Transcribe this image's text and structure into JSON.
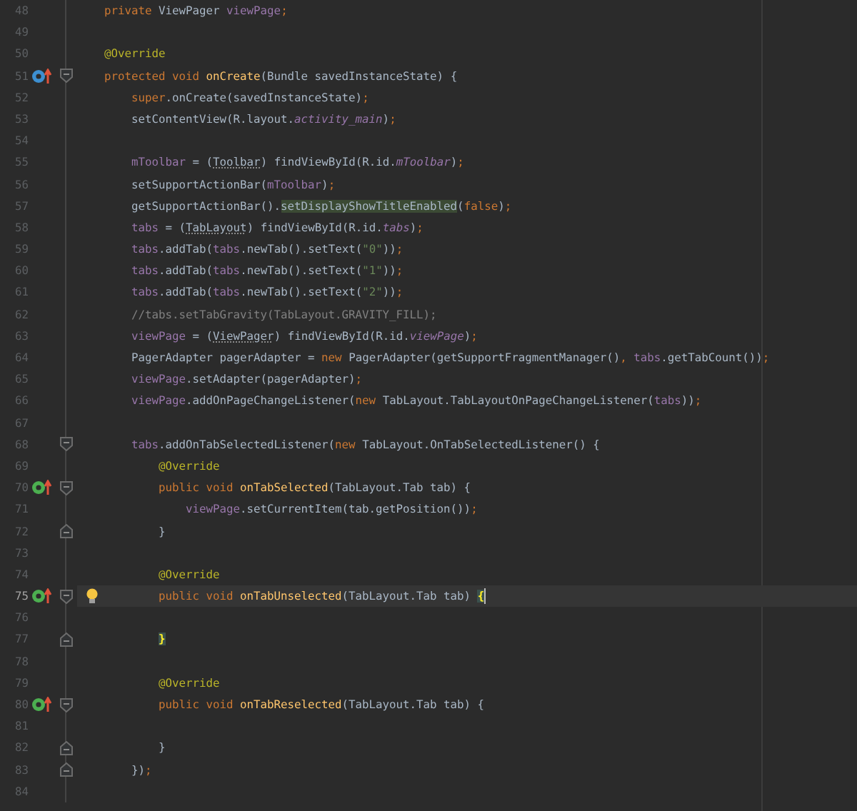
{
  "editor": {
    "lines": [
      {
        "number": "48",
        "current": false,
        "tokens": [
          {
            "kind": "keyword",
            "text": "    private"
          },
          {
            "kind": "plain",
            "text": " ViewPager "
          },
          {
            "kind": "field",
            "text": "viewPage"
          },
          {
            "kind": "keyword",
            "text": ";"
          }
        ]
      },
      {
        "number": "49",
        "current": false
      },
      {
        "number": "50",
        "current": false,
        "tokens": [
          {
            "kind": "annotation",
            "text": "    @Override"
          }
        ]
      },
      {
        "number": "51",
        "current": false,
        "gutter_icon": {
          "kind": "override"
        },
        "fold": {
          "kind": "start"
        },
        "tokens": [
          {
            "kind": "keyword",
            "text": "    protected void "
          },
          {
            "kind": "declaration",
            "text": "onCreate"
          },
          {
            "kind": "plain",
            "text": "(Bundle savedInstanceState) {"
          }
        ]
      },
      {
        "number": "52",
        "current": false,
        "tokens": [
          {
            "kind": "keyword",
            "text": "        super"
          },
          {
            "kind": "plain",
            "text": ".onCreate(savedInstanceState)"
          },
          {
            "kind": "keyword",
            "text": ";"
          }
        ]
      },
      {
        "number": "53",
        "current": false,
        "tokens": [
          {
            "kind": "plain",
            "text": "        setContentView(R.layout."
          },
          {
            "kind": "static",
            "text": "activity_main"
          },
          {
            "kind": "plain",
            "text": ")"
          },
          {
            "kind": "keyword",
            "text": ";"
          }
        ]
      },
      {
        "number": "54",
        "current": false
      },
      {
        "number": "55",
        "current": false,
        "tokens": [
          {
            "kind": "field",
            "text": "        mToolbar"
          },
          {
            "kind": "plain",
            "text": " = ("
          },
          {
            "kind": "warning",
            "text": "Toolbar"
          },
          {
            "kind": "plain",
            "text": ") findViewById(R.id."
          },
          {
            "kind": "static",
            "text": "mToolbar"
          },
          {
            "kind": "plain",
            "text": ")"
          },
          {
            "kind": "keyword",
            "text": ";"
          }
        ]
      },
      {
        "number": "56",
        "current": false,
        "tokens": [
          {
            "kind": "plain",
            "text": "        setSupportActionBar("
          },
          {
            "kind": "field",
            "text": "mToolbar"
          },
          {
            "kind": "plain",
            "text": ")"
          },
          {
            "kind": "keyword",
            "text": ";"
          }
        ]
      },
      {
        "number": "57",
        "current": false,
        "tokens": [
          {
            "kind": "plain",
            "text": "        getSupportActionBar()."
          },
          {
            "kind": "usage",
            "text": "setDisplayShowTitleEnabled"
          },
          {
            "kind": "plain",
            "text": "("
          },
          {
            "kind": "keyword",
            "text": "false"
          },
          {
            "kind": "plain",
            "text": ")"
          },
          {
            "kind": "keyword",
            "text": ";"
          }
        ]
      },
      {
        "number": "58",
        "current": false,
        "tokens": [
          {
            "kind": "field",
            "text": "        tabs"
          },
          {
            "kind": "plain",
            "text": " = ("
          },
          {
            "kind": "warning",
            "text": "TabLayout"
          },
          {
            "kind": "plain",
            "text": ") findViewById(R.id."
          },
          {
            "kind": "static",
            "text": "tabs"
          },
          {
            "kind": "plain",
            "text": ")"
          },
          {
            "kind": "keyword",
            "text": ";"
          }
        ]
      },
      {
        "number": "59",
        "current": false,
        "tokens": [
          {
            "kind": "field",
            "text": "        tabs"
          },
          {
            "kind": "plain",
            "text": ".addTab("
          },
          {
            "kind": "field",
            "text": "tabs"
          },
          {
            "kind": "plain",
            "text": ".newTab().setText("
          },
          {
            "kind": "string",
            "text": "\"0\""
          },
          {
            "kind": "plain",
            "text": "))"
          },
          {
            "kind": "keyword",
            "text": ";"
          }
        ]
      },
      {
        "number": "60",
        "current": false,
        "tokens": [
          {
            "kind": "field",
            "text": "        tabs"
          },
          {
            "kind": "plain",
            "text": ".addTab("
          },
          {
            "kind": "field",
            "text": "tabs"
          },
          {
            "kind": "plain",
            "text": ".newTab().setText("
          },
          {
            "kind": "string",
            "text": "\"1\""
          },
          {
            "kind": "plain",
            "text": "))"
          },
          {
            "kind": "keyword",
            "text": ";"
          }
        ]
      },
      {
        "number": "61",
        "current": false,
        "tokens": [
          {
            "kind": "field",
            "text": "        tabs"
          },
          {
            "kind": "plain",
            "text": ".addTab("
          },
          {
            "kind": "field",
            "text": "tabs"
          },
          {
            "kind": "plain",
            "text": ".newTab().setText("
          },
          {
            "kind": "string",
            "text": "\"2\""
          },
          {
            "kind": "plain",
            "text": "))"
          },
          {
            "kind": "keyword",
            "text": ";"
          }
        ]
      },
      {
        "number": "62",
        "current": false,
        "tokens": [
          {
            "kind": "comment",
            "text": "        //tabs.setTabGravity(TabLayout.GRAVITY_FILL);"
          }
        ]
      },
      {
        "number": "63",
        "current": false,
        "tokens": [
          {
            "kind": "field",
            "text": "        viewPage"
          },
          {
            "kind": "plain",
            "text": " = ("
          },
          {
            "kind": "warning",
            "text": "ViewPager"
          },
          {
            "kind": "plain",
            "text": ") findViewById(R.id."
          },
          {
            "kind": "static",
            "text": "viewPage"
          },
          {
            "kind": "plain",
            "text": ")"
          },
          {
            "kind": "keyword",
            "text": ";"
          }
        ]
      },
      {
        "number": "64",
        "current": false,
        "tokens": [
          {
            "kind": "plain",
            "text": "        PagerAdapter pagerAdapter = "
          },
          {
            "kind": "keyword",
            "text": "new"
          },
          {
            "kind": "plain",
            "text": " PagerAdapter(getSupportFragmentManager()"
          },
          {
            "kind": "keyword",
            "text": ", "
          },
          {
            "kind": "field",
            "text": "tabs"
          },
          {
            "kind": "plain",
            "text": ".getTabCount())"
          },
          {
            "kind": "keyword",
            "text": ";"
          }
        ]
      },
      {
        "number": "65",
        "current": false,
        "tokens": [
          {
            "kind": "field",
            "text": "        viewPage"
          },
          {
            "kind": "plain",
            "text": ".setAdapter(pagerAdapter)"
          },
          {
            "kind": "keyword",
            "text": ";"
          }
        ]
      },
      {
        "number": "66",
        "current": false,
        "tokens": [
          {
            "kind": "field",
            "text": "        viewPage"
          },
          {
            "kind": "plain",
            "text": ".addOnPageChangeListener("
          },
          {
            "kind": "keyword",
            "text": "new"
          },
          {
            "kind": "plain",
            "text": " TabLayout.TabLayoutOnPageChangeListener("
          },
          {
            "kind": "field",
            "text": "tabs"
          },
          {
            "kind": "plain",
            "text": "))"
          },
          {
            "kind": "keyword",
            "text": ";"
          }
        ]
      },
      {
        "number": "67",
        "current": false
      },
      {
        "number": "68",
        "current": false,
        "fold": {
          "kind": "start"
        },
        "tokens": [
          {
            "kind": "field",
            "text": "        tabs"
          },
          {
            "kind": "plain",
            "text": ".addOnTabSelectedListener("
          },
          {
            "kind": "keyword",
            "text": "new"
          },
          {
            "kind": "plain",
            "text": " TabLayout.OnTabSelectedListener() {"
          }
        ]
      },
      {
        "number": "69",
        "current": false,
        "tokens": [
          {
            "kind": "annotation",
            "text": "            @Override"
          }
        ]
      },
      {
        "number": "70",
        "current": false,
        "gutter_icon": {
          "kind": "implement"
        },
        "fold": {
          "kind": "start"
        },
        "tokens": [
          {
            "kind": "keyword",
            "text": "            public void "
          },
          {
            "kind": "declaration",
            "text": "onTabSelected"
          },
          {
            "kind": "plain",
            "text": "(TabLayout.Tab tab) {"
          }
        ]
      },
      {
        "number": "71",
        "current": false,
        "tokens": [
          {
            "kind": "field",
            "text": "                viewPage"
          },
          {
            "kind": "plain",
            "text": ".setCurrentItem(tab.getPosition())"
          },
          {
            "kind": "keyword",
            "text": ";"
          }
        ]
      },
      {
        "number": "72",
        "current": false,
        "fold": {
          "kind": "end"
        },
        "tokens": [
          {
            "kind": "plain",
            "text": "            }"
          }
        ]
      },
      {
        "number": "73",
        "current": false
      },
      {
        "number": "74",
        "current": false,
        "tokens": [
          {
            "kind": "annotation",
            "text": "            @Override"
          }
        ]
      },
      {
        "number": "75",
        "current": true,
        "gutter_icon": {
          "kind": "implement"
        },
        "fold": {
          "kind": "start"
        },
        "bulb": true,
        "caret": true,
        "tokens": [
          {
            "kind": "keyword",
            "text": "            public void "
          },
          {
            "kind": "declaration",
            "text": "onTabUnselected"
          },
          {
            "kind": "plain",
            "text": "(TabLayout.Tab tab) "
          },
          {
            "kind": "brace",
            "text": "{"
          }
        ]
      },
      {
        "number": "76",
        "current": false
      },
      {
        "number": "77",
        "current": false,
        "fold": {
          "kind": "end"
        },
        "tokens": [
          {
            "kind": "brace",
            "text": "            }"
          }
        ]
      },
      {
        "number": "78",
        "current": false
      },
      {
        "number": "79",
        "current": false,
        "tokens": [
          {
            "kind": "annotation",
            "text": "            @Override"
          }
        ]
      },
      {
        "number": "80",
        "current": false,
        "gutter_icon": {
          "kind": "implement"
        },
        "fold": {
          "kind": "start"
        },
        "tokens": [
          {
            "kind": "keyword",
            "text": "            public void "
          },
          {
            "kind": "declaration",
            "text": "onTabReselected"
          },
          {
            "kind": "plain",
            "text": "(TabLayout.Tab tab) {"
          }
        ]
      },
      {
        "number": "81",
        "current": false
      },
      {
        "number": "82",
        "current": false,
        "fold": {
          "kind": "end"
        },
        "tokens": [
          {
            "kind": "plain",
            "text": "            }"
          }
        ]
      },
      {
        "number": "83",
        "current": false,
        "fold": {
          "kind": "end"
        },
        "tokens": [
          {
            "kind": "plain",
            "text": "        })"
          },
          {
            "kind": "keyword",
            "text": ";"
          }
        ]
      },
      {
        "number": "84",
        "current": false
      }
    ]
  }
}
